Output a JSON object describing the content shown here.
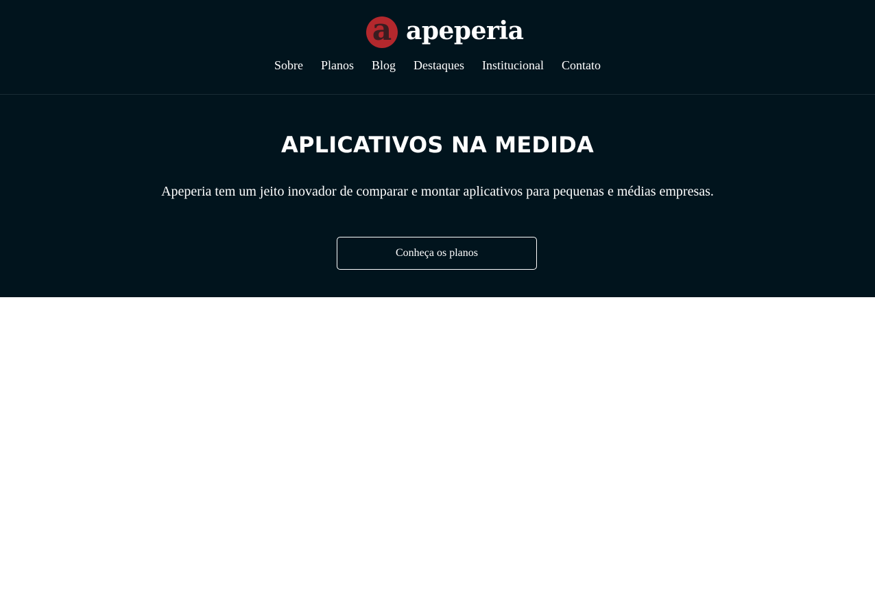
{
  "colors": {
    "background_dark": "#01141d",
    "brand_red": "#b3282d",
    "text_light": "#ffffff",
    "page_background": "#ffffff"
  },
  "header": {
    "logo": {
      "badge_letter": "a",
      "name": "apeperia"
    },
    "nav": [
      {
        "label": "Sobre"
      },
      {
        "label": "Planos"
      },
      {
        "label": "Blog"
      },
      {
        "label": "Destaques"
      },
      {
        "label": "Institucional"
      },
      {
        "label": "Contato"
      }
    ]
  },
  "hero": {
    "title": "APLICATIVOS NA MEDIDA",
    "text": "Apeperia tem um jeito inovador de comparar e montar aplicativos para pequenas e médias empresas.",
    "cta_label": "Conheça os planos"
  }
}
